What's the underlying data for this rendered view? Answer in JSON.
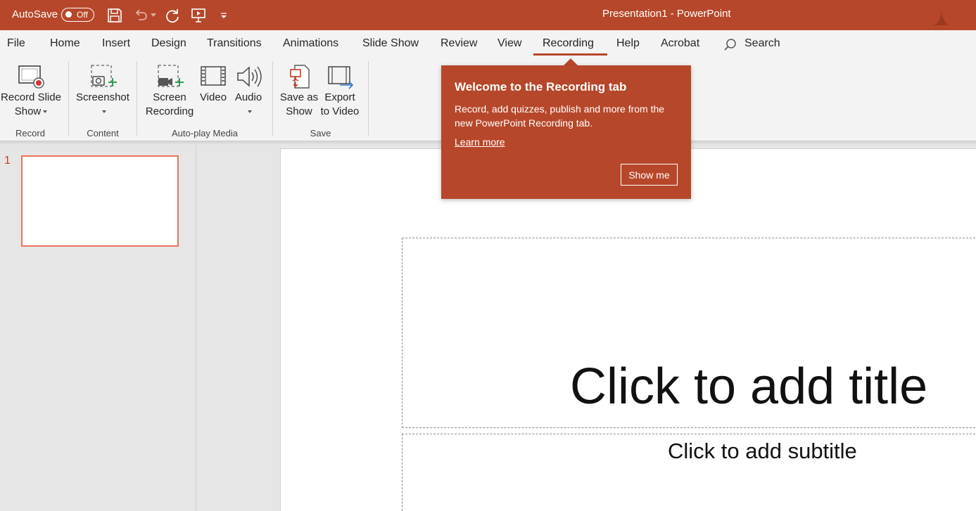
{
  "titlebar": {
    "autosave_label": "AutoSave",
    "autosave_state": "Off",
    "document_title": "Presentation1  -  PowerPoint"
  },
  "tabs": [
    "File",
    "Home",
    "Insert",
    "Design",
    "Transitions",
    "Animations",
    "Slide Show",
    "Review",
    "View",
    "Recording",
    "Help",
    "Acrobat"
  ],
  "active_tab": "Recording",
  "search": {
    "label": "Search"
  },
  "ribbon": {
    "record_slide_show_line1": "Record Slide",
    "record_slide_show_line2": "Show",
    "screenshot": "Screenshot",
    "screen_recording_line1": "Screen",
    "screen_recording_line2": "Recording",
    "video": "Video",
    "audio": "Audio",
    "save_as_show_line1": "Save as",
    "save_as_show_line2": "Show",
    "export_video_line1": "Export",
    "export_video_line2": "to Video",
    "groups": {
      "record": "Record",
      "content": "Content",
      "autoplay": "Auto-play Media",
      "save": "Save"
    }
  },
  "thumbnails": {
    "slide_number": "1"
  },
  "slide": {
    "title_placeholder": "Click to add title",
    "subtitle_placeholder": "Click to add subtitle"
  },
  "callout": {
    "title": "Welcome to the Recording tab",
    "body": "Record, add quizzes, publish and more from the new PowerPoint Recording tab.",
    "link": "Learn more",
    "button": "Show me"
  },
  "colors": {
    "accent": "#b7472a",
    "thumb_border": "#e8765a",
    "ribbon_bg": "#f3f3f3",
    "workspace_bg": "#e6e6e6"
  }
}
